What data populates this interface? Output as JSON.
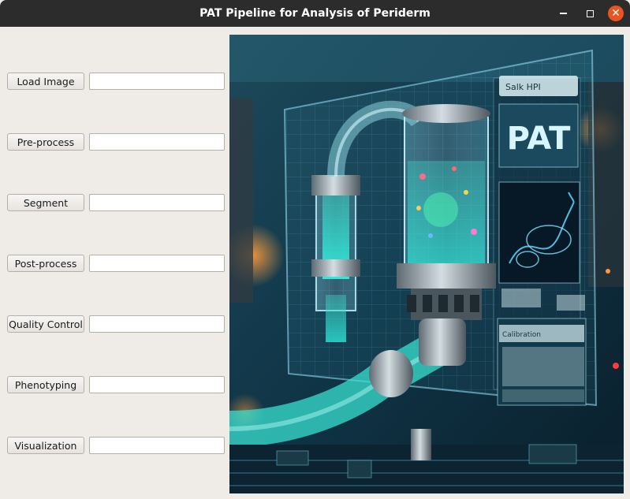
{
  "window": {
    "title": "PAT Pipeline for Analysis of Periderm",
    "controls": [
      "minimize-icon",
      "maximize-icon",
      "close-icon"
    ]
  },
  "steps": [
    {
      "button": "Load Image",
      "field_value": ""
    },
    {
      "button": "Pre-process",
      "field_value": ""
    },
    {
      "button": "Segment",
      "field_value": ""
    },
    {
      "button": "Post-process",
      "field_value": ""
    },
    {
      "button": "Quality Control",
      "field_value": ""
    },
    {
      "button": "Phenotyping",
      "field_value": ""
    },
    {
      "button": "Visualization",
      "field_value": ""
    }
  ],
  "banner": {
    "panel_header": "Salk HPI",
    "logo_text": "PAT",
    "calibration_label": "Calibration"
  },
  "colors": {
    "titlebar": "#2c2c2c",
    "close_button": "#e95420",
    "window_bg": "#efece8"
  }
}
